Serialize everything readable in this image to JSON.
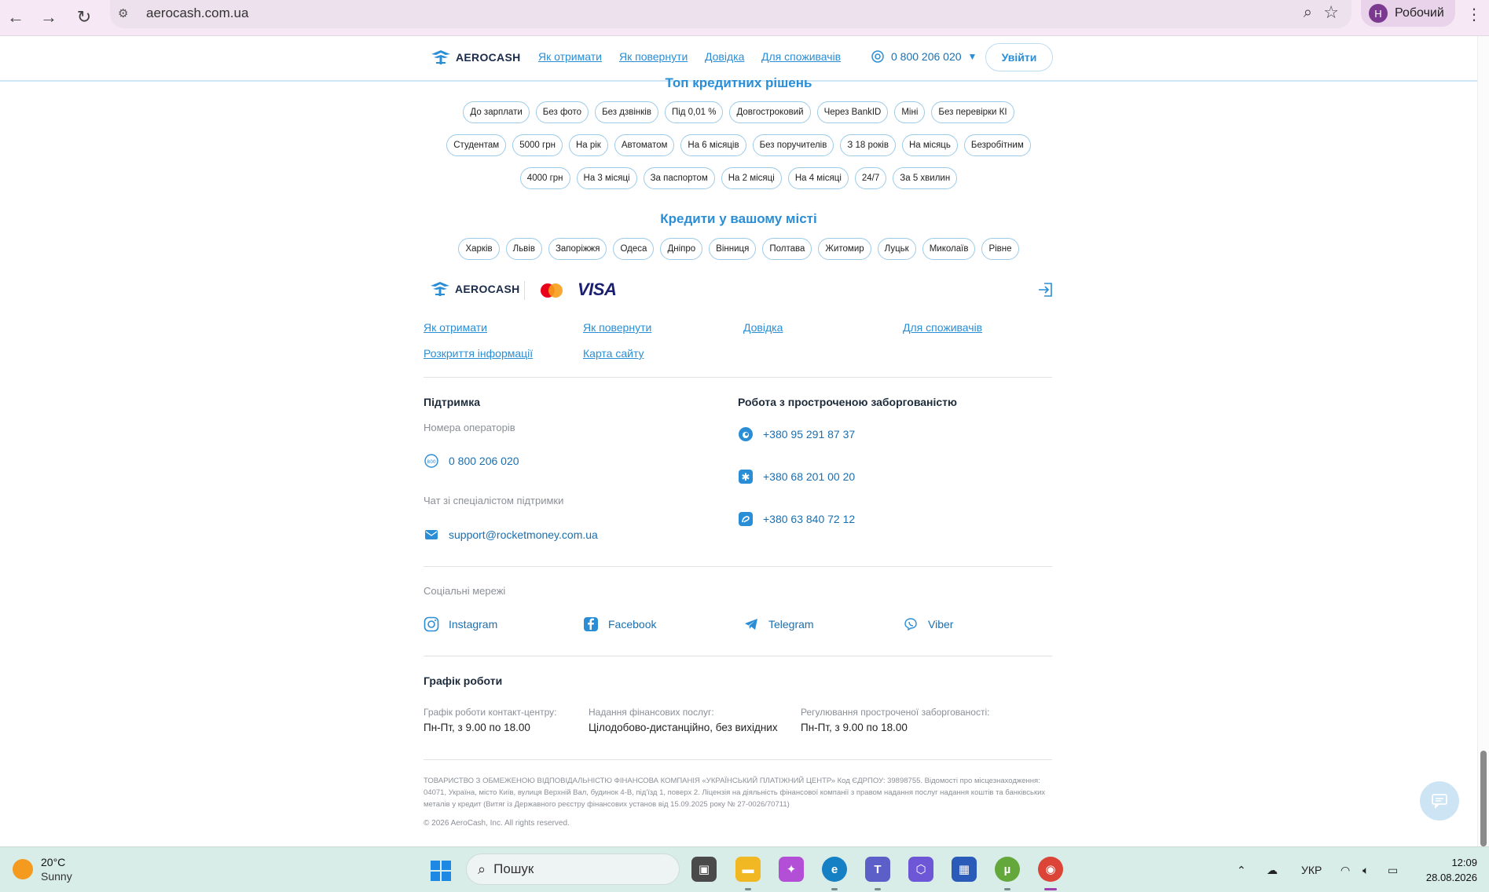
{
  "browser": {
    "url": "aerocash.com.ua",
    "profile_initial": "Н",
    "profile_name": "Робочий"
  },
  "header": {
    "logo_text": "AEROCASH",
    "nav": [
      "Як отримати",
      "Як повернути",
      "Довідка",
      "Для споживачів"
    ],
    "phone": "0 800 206 020",
    "login": "Увійти"
  },
  "top_solutions": {
    "title": "Топ кредитних рішень",
    "row1": [
      "До зарплати",
      "Без фото",
      "Без дзвінків",
      "Під 0,01 %",
      "Довгостроковий",
      "Через BankID",
      "Міні",
      "Без перевірки КІ"
    ],
    "row2": [
      "Студентам",
      "5000 грн",
      "На рік",
      "Автоматом",
      "На 6 місяців",
      "Без поручителів",
      "З 18 років",
      "На місяць",
      "Безробітним"
    ],
    "row3": [
      "4000 грн",
      "На 3 місяці",
      "За паспортом",
      "На 2 місяці",
      "На 4 місяці",
      "24/7",
      "За 5 хвилин"
    ]
  },
  "cities": {
    "title": "Кредити у вашому місті",
    "items": [
      "Харків",
      "Львів",
      "Запоріжжя",
      "Одеса",
      "Дніпро",
      "Вінниця",
      "Полтава",
      "Житомир",
      "Луцьк",
      "Миколаїв",
      "Рівне"
    ]
  },
  "footer": {
    "logo_text": "AEROCASH",
    "visa": "VISA",
    "links_row1": [
      "Як отримати",
      "Як повернути",
      "Довідка",
      "Для споживачів"
    ],
    "links_row2": [
      "Розкриття інформації",
      "Карта сайту"
    ],
    "support": {
      "title": "Підтримка",
      "operators_label": "Номера операторів",
      "phone": "0 800 206 020",
      "chat_label": "Чат зі спеціалістом підтримки",
      "email": "support@rocketmoney.com.ua"
    },
    "overdue": {
      "title": "Робота з простроченою заборгованістю",
      "phones": [
        "+380 95 291 87 37",
        "+380 68 201 00 20",
        "+380 63 840 72 12"
      ]
    },
    "social": {
      "title": "Соціальні мережі",
      "items": [
        "Instagram",
        "Facebook",
        "Telegram",
        "Viber"
      ]
    },
    "schedule": {
      "title": "Графік роботи",
      "items": [
        {
          "label": "Графік роботи контакт-центру:",
          "value": "Пн-Пт, з 9.00 по 18.00"
        },
        {
          "label": "Надання фінансових послуг:",
          "value": "Цілодобово-дистанційно, без вихідних"
        },
        {
          "label": "Регулювання простроченої заборгованості:",
          "value": "Пн-Пт, з 9.00 по 18.00"
        }
      ]
    },
    "legal": "ТОВАРИСТВО З ОБМЕЖЕНОЮ ВІДПОВІДАЛЬНІСТЮ ФІНАНСОВА КОМПАНІЯ «УКРАЇНСЬКИЙ ПЛАТІЖНИЙ ЦЕНТР» Код ЄДРПОУ: 39898755. Відомості про місцезнаходження: 04071, Україна, місто Київ, вулиця Верхній Вал, будинок 4-В, під'їзд 1, поверх 2. Ліцензія на діяльність фінансової компанії з правом надання послуг надання коштів та банківських металів у кредит (Витяг із Державного реєстру фінансових установ від 15.09.2025 року № 27-0026/70711)",
    "copyright": "© 2026 AeroCash, Inc. All rights reserved."
  },
  "taskbar": {
    "temp": "20°C",
    "condition": "Sunny",
    "search": "Пошук",
    "lang": "УКР",
    "time": "12:09",
    "date": "28.08.2026"
  },
  "colors": {
    "accent": "#2a8ed6",
    "chip_border": "#9ccbe9",
    "chrome_bg": "#f6e9f5",
    "taskbar_bg": "#d8ece8"
  }
}
